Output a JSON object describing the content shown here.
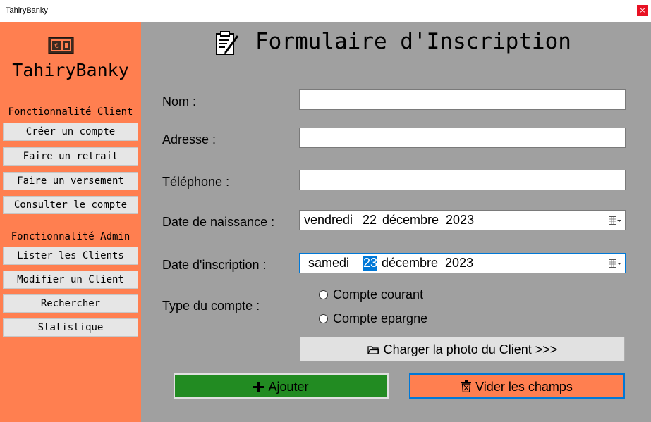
{
  "window": {
    "title": "TahiryBanky",
    "close_glyph": "×"
  },
  "sidebar": {
    "brand": "TahiryBanky",
    "client_section_label": "Fonctionnalité Client",
    "client_items": [
      "Créer un compte",
      "Faire un retrait",
      "Faire un versement",
      "Consulter le compte"
    ],
    "admin_section_label": "Fonctionnalité Admin",
    "admin_items": [
      "Lister les Clients",
      "Modifier un Client",
      "Rechercher",
      "Statistique"
    ]
  },
  "form": {
    "title": "Formulaire d'Inscription",
    "nom_label": "Nom :",
    "nom_value": "",
    "adresse_label": "Adresse :",
    "adresse_value": "",
    "telephone_label": "Téléphone :",
    "telephone_value": "",
    "naissance_label": "Date de naissance :",
    "naissance_weekday": "vendredi",
    "naissance_day": "22",
    "naissance_month_year": "décembre  2023",
    "inscription_label": "Date d'inscription :",
    "inscription_weekday": "samedi",
    "inscription_day": "23",
    "inscription_month_year": "décembre  2023",
    "type_label": "Type du compte :",
    "type_options": [
      "Compte courant",
      "Compte epargne"
    ],
    "photo_button": "Charger la photo du Client >>>",
    "add_button": "Ajouter",
    "clear_button": "Vider les champs"
  },
  "colors": {
    "sidebar_bg": "#ff7f50",
    "main_bg": "#a0a0a0",
    "add_button_bg": "#228b22",
    "clear_button_bg": "#ff7f50",
    "selection": "#0078d7"
  },
  "icons": {
    "logo": "money-icon",
    "form": "form-edit-icon",
    "calendar": "calendar-icon",
    "folder": "folder-icon",
    "plus": "plus-icon",
    "trash": "trash-icon"
  }
}
